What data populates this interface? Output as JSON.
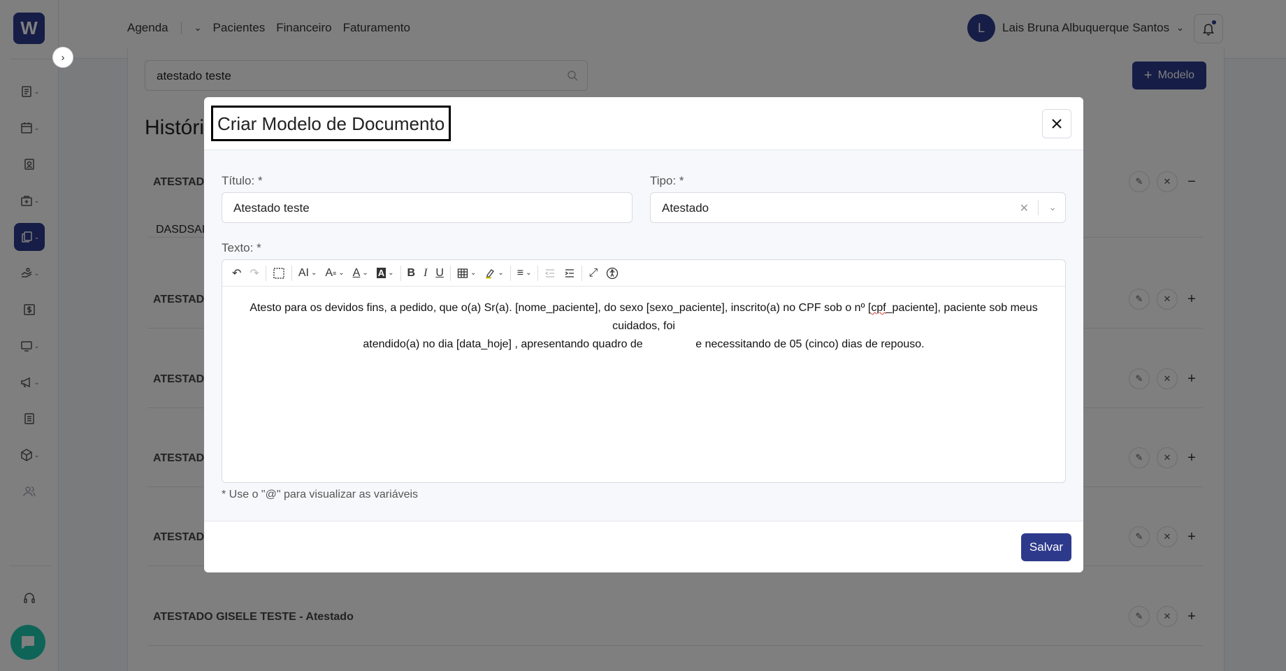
{
  "nav": {
    "items": [
      {
        "label": "Agenda"
      },
      {
        "label": "Pacientes"
      },
      {
        "label": "Financeiro"
      },
      {
        "label": "Faturamento"
      }
    ]
  },
  "user": {
    "initial": "L",
    "name": "Lais Bruna Albuquerque Santos"
  },
  "logo": {
    "letter": "W"
  },
  "search": {
    "value": "atestado teste"
  },
  "add_model_label": "Modelo",
  "history_title": "Históri",
  "rows": [
    {
      "title": "ATESTAD",
      "toggle": "−",
      "body": "DASDSAI"
    },
    {
      "title": "ATESTAD",
      "toggle": "+"
    },
    {
      "title": "ATESTAD",
      "toggle": "+"
    },
    {
      "title": "ATESTAD",
      "toggle": "+"
    },
    {
      "title": "ATESTAD",
      "toggle": "+"
    },
    {
      "title": "ATESTADO GISELE TESTE - Atestado",
      "toggle": "+"
    }
  ],
  "modal": {
    "title": "Criar Modelo de Documento",
    "titulo_label": "Título: *",
    "titulo_value": "Atestado teste",
    "tipo_label": "Tipo: *",
    "tipo_value": "Atestado",
    "texto_label": "Texto: *",
    "editor_line1_a": "Atesto para os devidos fins, a pedido, que o(a) Sr(a). [nome_paciente], do sexo [sexo_paciente], inscrito(a) no CPF sob o nº [",
    "editor_line1_spell": "cpf",
    "editor_line1_b": "_paciente], paciente sob meus cuidados, foi",
    "editor_line2": "atendido(a) no dia [data_hoje] , apresentando quadro de                 e necessitando de 05 (cinco) dias de repouso.",
    "hint": "* Use o \"@\" para visualizar as variáveis",
    "save_label": "Salvar"
  },
  "colors": {
    "primary": "#2d3a8c",
    "chat": "#1ec9b0"
  }
}
